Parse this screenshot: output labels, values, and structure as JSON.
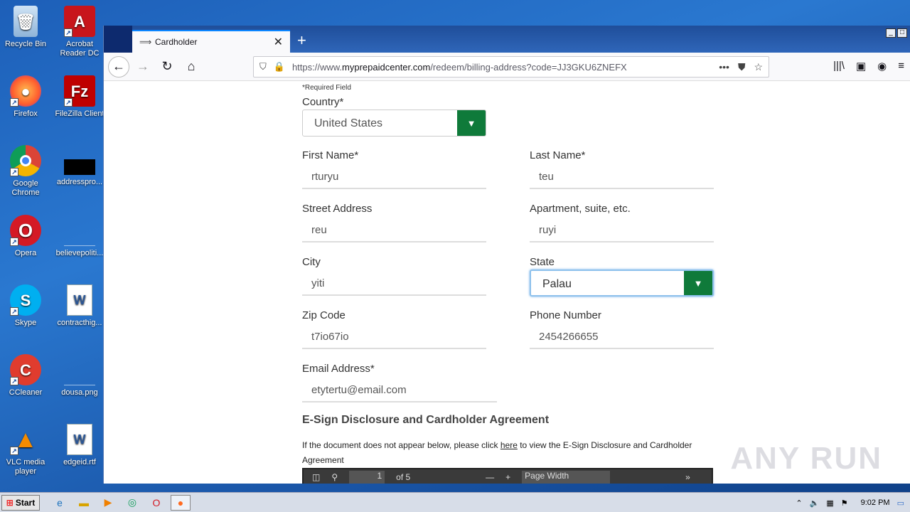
{
  "desktop": {
    "icons": [
      {
        "label": "Recycle Bin",
        "icon": "recycle-bin-icon"
      },
      {
        "label": "Acrobat Reader DC",
        "icon": "acrobat-icon"
      },
      {
        "label": "Firefox",
        "icon": "firefox-icon"
      },
      {
        "label": "FileZilla Client",
        "icon": "filezilla-icon"
      },
      {
        "label": "Google Chrome",
        "icon": "chrome-icon"
      },
      {
        "label": "addresspro...",
        "icon": "file-icon"
      },
      {
        "label": "Opera",
        "icon": "opera-icon"
      },
      {
        "label": "believepoliti...",
        "icon": "file-icon"
      },
      {
        "label": "Skype",
        "icon": "skype-icon"
      },
      {
        "label": "contracthig...",
        "icon": "word-doc-icon"
      },
      {
        "label": "CCleaner",
        "icon": "ccleaner-icon"
      },
      {
        "label": "dousa.png",
        "icon": "image-file-icon"
      },
      {
        "label": "VLC media player",
        "icon": "vlc-icon"
      },
      {
        "label": "edgeid.rtf",
        "icon": "word-doc-icon"
      }
    ]
  },
  "browser": {
    "tab_title": "Cardholder",
    "url_prefix": "https://www.",
    "url_host": "myprepaidcenter.com",
    "url_path": "/redeem/billing-address?code=JJ3GKU6ZNEFX"
  },
  "form": {
    "required_note": "*Required Field",
    "country_label": "Country*",
    "country_value": "United States",
    "first_name_label": "First Name*",
    "first_name_value": "rturyu",
    "last_name_label": "Last Name*",
    "last_name_value": "teu",
    "street_label": "Street Address",
    "street_value": "reu",
    "apt_label": "Apartment, suite, etc.",
    "apt_value": "ruyi",
    "city_label": "City",
    "city_value": "yiti",
    "state_label": "State",
    "state_value": "Palau",
    "zip_label": "Zip Code",
    "zip_value": "t7io67io",
    "phone_label": "Phone Number",
    "phone_value": "2454266655",
    "email_label": "Email Address*",
    "email_value": "etytertu@email.com",
    "esign_title": "E-Sign Disclosure and Cardholder Agreement",
    "disclosure_before": "If the document does not appear below, please click ",
    "disclosure_link": "here",
    "disclosure_after": " to view the E-Sign Disclosure and Cardholder Agreement",
    "pdf_page": "1",
    "pdf_of": "of 5",
    "pdf_zoom": "Page Width"
  },
  "watermark": "ANY RUN",
  "taskbar": {
    "start_label": "Start",
    "clock": "9:02 PM"
  }
}
